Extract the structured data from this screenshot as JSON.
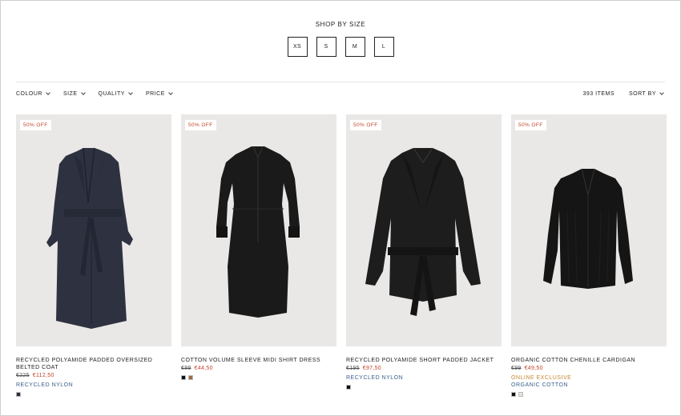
{
  "shop_by_size": {
    "title": "SHOP BY SIZE",
    "sizes": [
      "XS",
      "S",
      "M",
      "L"
    ]
  },
  "filters": [
    "COLOUR",
    "SIZE",
    "QUALITY",
    "PRICE"
  ],
  "items_count": "393 ITEMS",
  "sort_label": "SORT BY",
  "colors": {
    "sale_red": "#c1452b",
    "material_blue": "#3a5f8c",
    "exclusive_orange": "#c6892f"
  },
  "products": [
    {
      "badge": "50% OFF",
      "name": "RECYCLED POLYAMIDE PADDED OVERSIZED BELTED COAT",
      "old_price": "€225",
      "new_price": "€112,50",
      "tags": [
        "RECYCLED NYLON"
      ],
      "swatches": [
        "#2b2e38"
      ],
      "icon": "navy-belted-coat"
    },
    {
      "badge": "50% OFF",
      "name": "COTTON VOLUME SLEEVE MIDI SHIRT DRESS",
      "old_price": "€89",
      "new_price": "€44,50",
      "tags": [],
      "swatches": [
        "#111111",
        "#9a6b42"
      ],
      "icon": "black-shirt-dress"
    },
    {
      "badge": "50% OFF",
      "name": "RECYCLED POLYAMIDE SHORT PADDED JACKET",
      "old_price": "€195",
      "new_price": "€97,50",
      "tags": [
        "RECYCLED NYLON"
      ],
      "swatches": [
        "#111111"
      ],
      "icon": "black-padded-jacket"
    },
    {
      "badge": "50% OFF",
      "name": "ORGANIC COTTON CHENILLE CARDIGAN",
      "old_price": "€99",
      "new_price": "€49,50",
      "tags": [
        "ONLINE EXCLUSIVE",
        "ORGANIC COTTON"
      ],
      "swatches": [
        "#111111",
        "#e8e3d8"
      ],
      "icon": "black-cardigan"
    }
  ]
}
